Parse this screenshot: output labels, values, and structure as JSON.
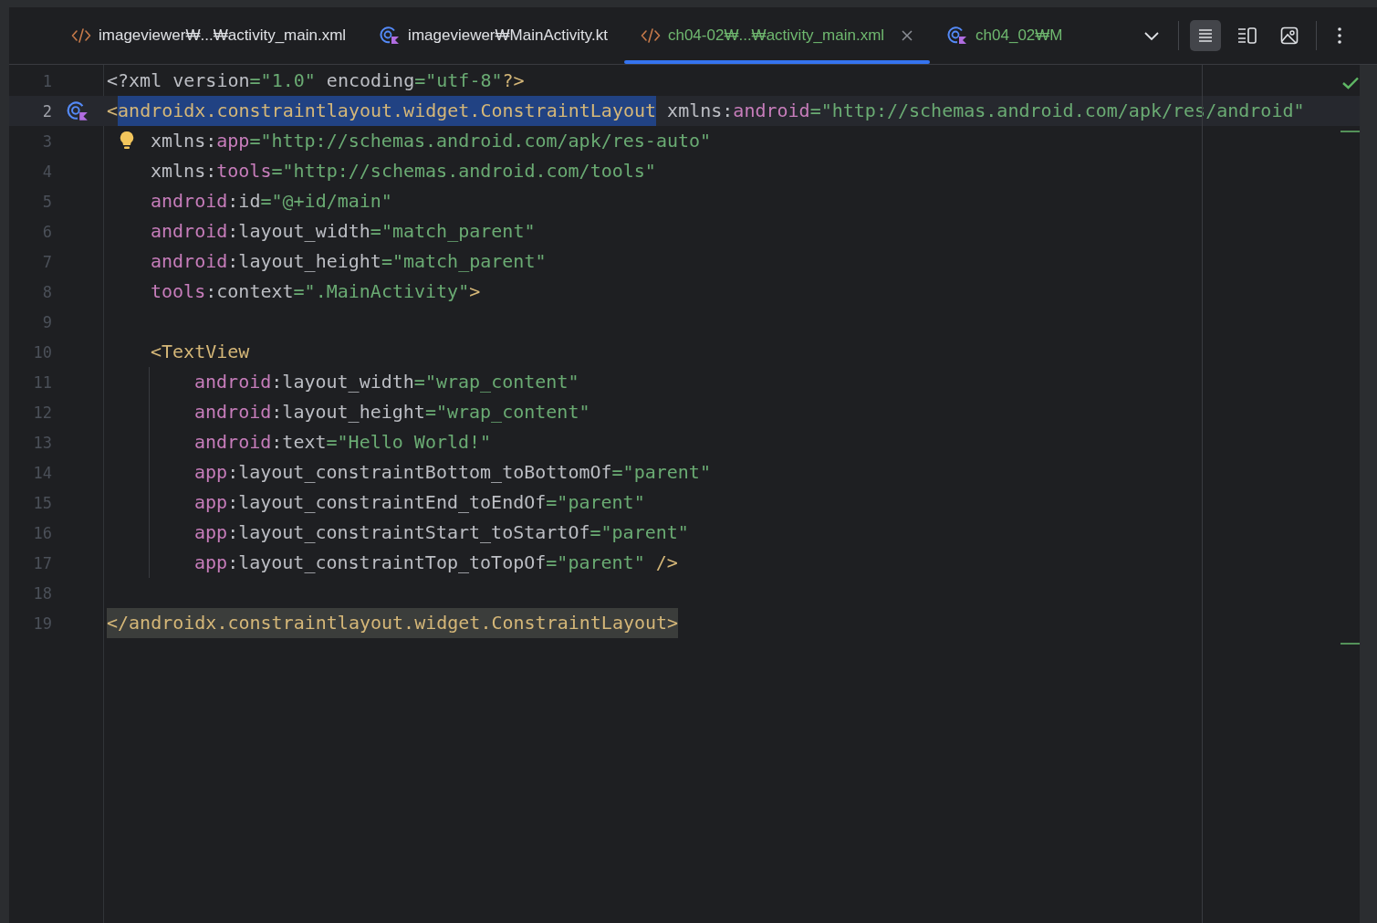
{
  "tabs": [
    {
      "label": "imageviewer₩...₩activity_main.xml",
      "kind": "xml",
      "selected": false,
      "added": false
    },
    {
      "label": "imageviewer₩MainActivity.kt",
      "kind": "kotlin",
      "selected": false,
      "added": false
    },
    {
      "label": "ch04-02₩...₩activity_main.xml",
      "kind": "xml",
      "selected": true,
      "added": true
    },
    {
      "label": "ch04_02₩M",
      "kind": "kotlin",
      "selected": false,
      "added": true
    }
  ],
  "view_modes": [
    {
      "kind": "code",
      "selected": true
    },
    {
      "kind": "split",
      "selected": false
    },
    {
      "kind": "design",
      "selected": false
    }
  ],
  "lines": [
    {
      "number": "1",
      "current": false,
      "tokens": [
        {
          "text": "<?xml ",
          "kind": "plain"
        },
        {
          "text": "version",
          "kind": "plain"
        },
        {
          "text": "=\"1.0\" ",
          "kind": "str"
        },
        {
          "text": "encoding",
          "kind": "plain"
        },
        {
          "text": "=\"utf-8\"",
          "kind": "str"
        },
        {
          "text": "?>",
          "kind": "tag"
        }
      ]
    },
    {
      "number": "2",
      "current": true,
      "kind": "class_marker",
      "tokens": [
        {
          "text": "<",
          "kind": "tag"
        },
        {
          "text": "androidx.constraintlayout.widget.ConstraintLayout",
          "kind": "tag_selected"
        },
        {
          "text": " xmlns:",
          "kind": "plain"
        },
        {
          "text": "android",
          "kind": "ns"
        },
        {
          "text": "=\"http://schemas.android.com/apk/res/android\"",
          "kind": "str"
        }
      ],
      "children": [
        {
          "number": "3",
          "current": false,
          "kind": "bulb",
          "tokens": [
            {
              "text": "xmlns:",
              "kind": "plain"
            },
            {
              "text": "app",
              "kind": "ns"
            },
            {
              "text": "=\"http://schemas.android.com/apk/res-auto\"",
              "kind": "str"
            }
          ]
        },
        {
          "number": "4",
          "current": false,
          "tokens": [
            {
              "text": "xmlns:",
              "kind": "plain"
            },
            {
              "text": "tools",
              "kind": "ns"
            },
            {
              "text": "=\"http://schemas.android.com/tools\"",
              "kind": "str"
            }
          ]
        },
        {
          "number": "5",
          "current": false,
          "tokens": [
            {
              "text": "android",
              "kind": "ns"
            },
            {
              "text": ":id",
              "kind": "plain"
            },
            {
              "text": "=\"@+id/main\"",
              "kind": "str"
            }
          ]
        },
        {
          "number": "6",
          "current": false,
          "tokens": [
            {
              "text": "android",
              "kind": "ns"
            },
            {
              "text": ":layout_width",
              "kind": "plain"
            },
            {
              "text": "=\"match_parent\"",
              "kind": "str"
            }
          ]
        },
        {
          "number": "7",
          "current": false,
          "tokens": [
            {
              "text": "android",
              "kind": "ns"
            },
            {
              "text": ":layout_height",
              "kind": "plain"
            },
            {
              "text": "=\"match_parent\"",
              "kind": "str"
            }
          ]
        },
        {
          "number": "8",
          "current": false,
          "tokens": [
            {
              "text": "tools",
              "kind": "ns"
            },
            {
              "text": ":context",
              "kind": "plain"
            },
            {
              "text": "=\".MainActivity\"",
              "kind": "str"
            },
            {
              "text": ">",
              "kind": "tag"
            }
          ]
        },
        {
          "number": "9",
          "current": false
        },
        {
          "number": "10",
          "current": false,
          "tokens": [
            {
              "text": "<TextView",
              "kind": "tag"
            }
          ],
          "children": [
            {
              "number": "11",
              "current": false,
              "tokens": [
                {
                  "text": "android",
                  "kind": "ns"
                },
                {
                  "text": ":layout_width",
                  "kind": "plain"
                },
                {
                  "text": "=\"wrap_content\"",
                  "kind": "str"
                }
              ]
            },
            {
              "number": "12",
              "current": false,
              "tokens": [
                {
                  "text": "android",
                  "kind": "ns"
                },
                {
                  "text": ":layout_height",
                  "kind": "plain"
                },
                {
                  "text": "=\"wrap_content\"",
                  "kind": "str"
                }
              ]
            },
            {
              "number": "13",
              "current": false,
              "tokens": [
                {
                  "text": "android",
                  "kind": "ns"
                },
                {
                  "text": ":text",
                  "kind": "plain"
                },
                {
                  "text": "=\"Hello World!\"",
                  "kind": "str"
                }
              ]
            },
            {
              "number": "14",
              "current": false,
              "tokens": [
                {
                  "text": "app",
                  "kind": "ns"
                },
                {
                  "text": ":layout_constraintBottom_toBottomOf",
                  "kind": "plain"
                },
                {
                  "text": "=\"parent\"",
                  "kind": "str"
                }
              ]
            },
            {
              "number": "15",
              "current": false,
              "tokens": [
                {
                  "text": "app",
                  "kind": "ns"
                },
                {
                  "text": ":layout_constraintEnd_toEndOf",
                  "kind": "plain"
                },
                {
                  "text": "=\"parent\"",
                  "kind": "str"
                }
              ]
            },
            {
              "number": "16",
              "current": false,
              "tokens": [
                {
                  "text": "app",
                  "kind": "ns"
                },
                {
                  "text": ":layout_constraintStart_toStartOf",
                  "kind": "plain"
                },
                {
                  "text": "=\"parent\"",
                  "kind": "str"
                }
              ]
            },
            {
              "number": "17",
              "current": false,
              "tokens": [
                {
                  "text": "app",
                  "kind": "ns"
                },
                {
                  "text": ":layout_constraintTop_toTopOf",
                  "kind": "plain"
                },
                {
                  "text": "=\"parent\"",
                  "kind": "str"
                },
                {
                  "text": " />",
                  "kind": "tag"
                }
              ]
            }
          ]
        }
      ]
    },
    {
      "number": "18",
      "current": false
    },
    {
      "number": "19",
      "current": false,
      "tokens": [
        {
          "text": "</androidx.constraintlayout.widget.ConstraintLayout>",
          "kind": "tag_match"
        }
      ]
    }
  ]
}
